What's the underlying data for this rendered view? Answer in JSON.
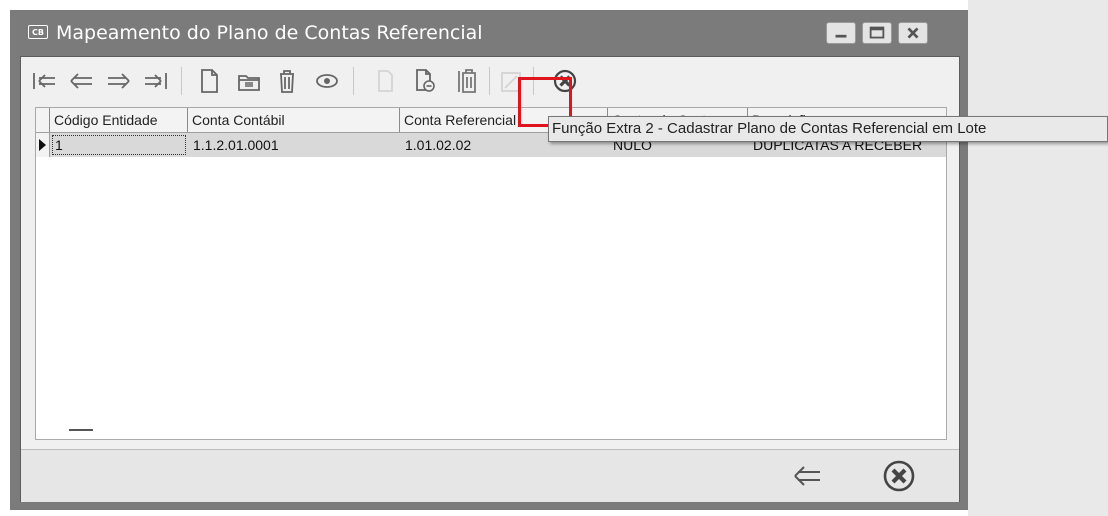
{
  "window": {
    "title": "Mapeamento do Plano de Contas Referencial",
    "app_badge": "CB"
  },
  "toolbar": {
    "buttons": [
      {
        "name": "first-record-icon"
      },
      {
        "name": "previous-record-icon"
      },
      {
        "name": "next-record-icon"
      },
      {
        "name": "last-record-icon"
      },
      {
        "name": "new-document-icon"
      },
      {
        "name": "edit-folder-icon"
      },
      {
        "name": "delete-trash-icon"
      },
      {
        "name": "view-eye-icon"
      },
      {
        "name": "extra-function-1-icon"
      },
      {
        "name": "extra-function-2-icon"
      },
      {
        "name": "clipboard-paste-icon"
      },
      {
        "name": "edit-pencil-icon"
      },
      {
        "name": "cancel-close-icon"
      }
    ]
  },
  "tooltip": {
    "text": "Função Extra 2 - Cadastrar Plano de Contas Referencial em Lote"
  },
  "grid": {
    "columns": [
      "Código Entidade",
      "Conta Contábil",
      "Conta Referencial",
      "Centro de Custo",
      "Descrição"
    ],
    "rows": [
      [
        "1",
        "1.1.2.01.0001",
        "1.01.02.02",
        "NULO",
        "DUPLICATAS A RECEBER"
      ]
    ]
  },
  "colors": {
    "titlebar": "#7b7b7b",
    "highlight": "#e0141c",
    "selected_row": "#d9d9d9"
  }
}
